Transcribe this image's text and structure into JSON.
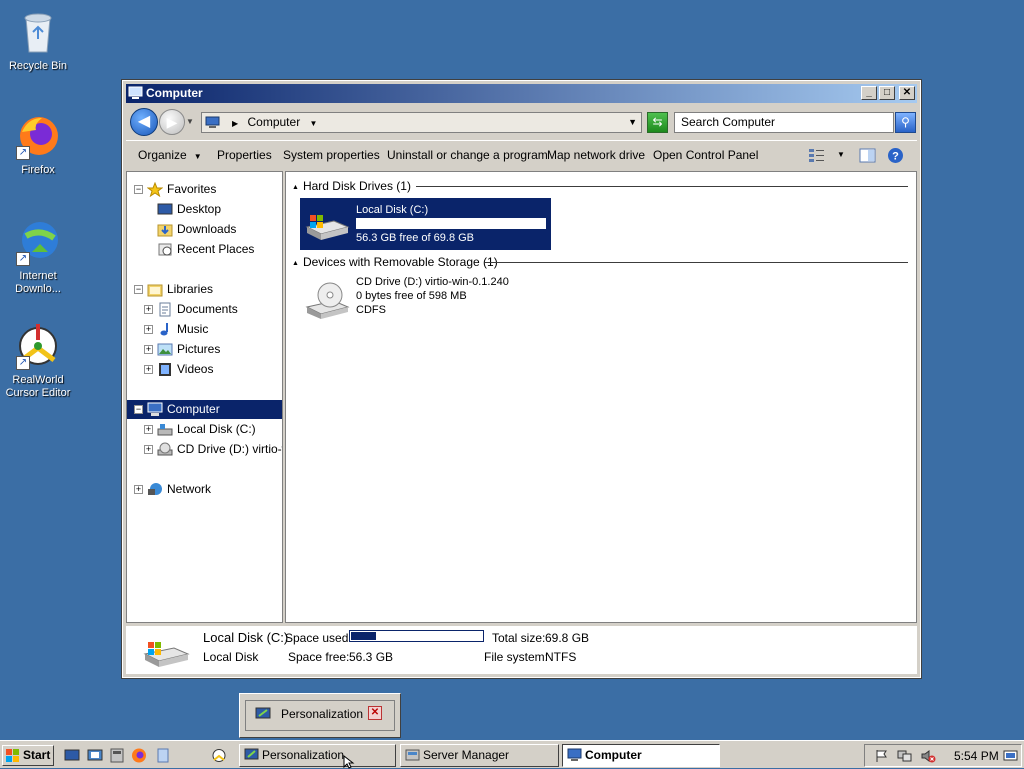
{
  "desktop": {
    "icons": [
      {
        "label": "Recycle Bin",
        "icon": "recycle-bin-icon"
      },
      {
        "label": "Firefox",
        "icon": "firefox-icon"
      },
      {
        "label_line1": "Internet",
        "label_line2": "Downlo...",
        "icon": "internet-download-manager-icon"
      },
      {
        "label_line1": "RealWorld",
        "label_line2": "Cursor Editor",
        "icon": "realworld-cursor-editor-icon"
      }
    ]
  },
  "window": {
    "title": "Computer",
    "controls": {
      "minimize": "_",
      "maximize": "□",
      "close": "✕"
    },
    "address": {
      "location": "Computer",
      "search_placeholder": "Search Computer"
    },
    "commands": {
      "organize": "Organize",
      "properties": "Properties",
      "system_properties": "System properties",
      "uninstall": "Uninstall or change a program",
      "map_drive": "Map network drive",
      "control_panel": "Open Control Panel"
    },
    "nav": {
      "favorites": "Favorites",
      "desktop": "Desktop",
      "downloads": "Downloads",
      "recent_places": "Recent Places",
      "libraries": "Libraries",
      "documents": "Documents",
      "music": "Music",
      "pictures": "Pictures",
      "videos": "Videos",
      "computer": "Computer",
      "local_disk": "Local Disk (C:)",
      "cd_drive": "CD Drive (D:) virtio-wi",
      "network": "Network"
    },
    "groups": {
      "hard_disk": "Hard Disk Drives (1)",
      "removable": "Devices with Removable Storage (1)"
    },
    "drives": {
      "c": {
        "name": "Local Disk (C:)",
        "free_text": "56.3 GB free of 69.8 GB",
        "used_fraction": 0.19
      },
      "d": {
        "name": "CD Drive (D:) virtio-win-0.1.240",
        "free_text": "0 bytes free of 598 MB",
        "fs": "CDFS"
      }
    },
    "details": {
      "name": "Local Disk (C:)",
      "type": "Local Disk",
      "space_used_label": "Space used:",
      "space_free_label": "Space free:",
      "space_free_value": "56.3 GB",
      "total_size_label": "Total size:",
      "total_size_value": "69.8 GB",
      "filesystem_label": "File system:",
      "filesystem_value": "NTFS",
      "used_fraction": 0.19
    }
  },
  "taskbar": {
    "start": "Start",
    "popup": {
      "label": "Personalization"
    },
    "tasks": [
      {
        "label": "Personalization"
      },
      {
        "label": "Server Manager"
      },
      {
        "label": "Computer"
      }
    ],
    "clock": "5:54 PM"
  },
  "colors": {
    "desktop": "#3b6ea5",
    "selection": "#0a246a",
    "title_gradient_end": "#a6caf0"
  }
}
